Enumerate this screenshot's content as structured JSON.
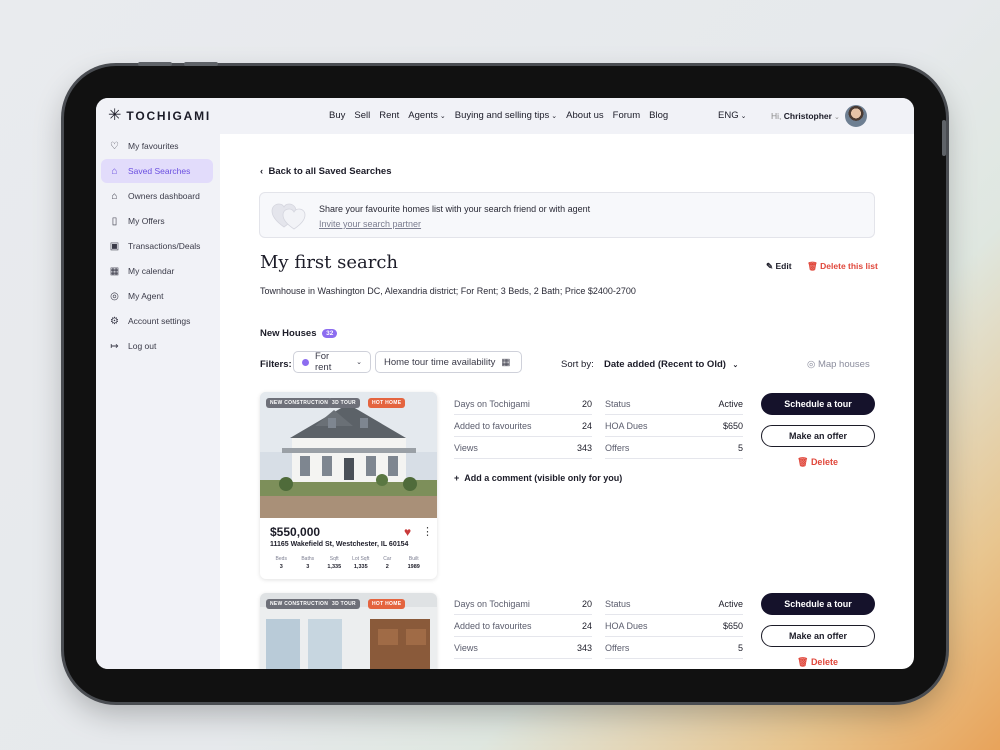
{
  "header": {
    "logo": "TOCHIGAMI",
    "nav": [
      "Buy",
      "Sell",
      "Rent",
      "Agents",
      "Buying and selling tips",
      "About us",
      "Forum",
      "Blog"
    ],
    "language": "ENG",
    "greeting": "Hi,",
    "user_name": "Christopher"
  },
  "sidebar": {
    "items": [
      {
        "label": "My favourites",
        "icon": "heart-icon"
      },
      {
        "label": "Saved Searches",
        "icon": "saved-search-icon",
        "active": true
      },
      {
        "label": "Owners dashboard",
        "icon": "home-icon"
      },
      {
        "label": "My Offers",
        "icon": "document-icon"
      },
      {
        "label": "Transactions/Deals",
        "icon": "briefcase-icon"
      },
      {
        "label": "My calendar",
        "icon": "calendar-icon"
      },
      {
        "label": "My Agent",
        "icon": "user-icon"
      },
      {
        "label": "Account settings",
        "icon": "gear-icon"
      },
      {
        "label": "Log out",
        "icon": "logout-icon"
      }
    ]
  },
  "main": {
    "back_label": "Back to all Saved Searches",
    "share": {
      "text": "Share your favourite homes list with your search friend or with agent",
      "link": "Invite your search partner"
    },
    "title": "My first search",
    "edit_label": "Edit",
    "delete_list_label": "Delete this list",
    "description": "Townhouse in Washington DC, Alexandria district; For Rent; 3 Beds, 2 Bath; Price $2400-2700",
    "section_title": "New Houses",
    "section_count": "32",
    "filters_label": "Filters:",
    "filter_rent": "For rent",
    "filter_tour": "Home tour time availability",
    "sort_label": "Sort by:",
    "sort_value": "Date added (Recent to Old)",
    "map_label": "Map houses"
  },
  "listings": [
    {
      "badges": [
        "NEW CONSTRUCTION",
        "3D TOUR",
        "HOT HOME"
      ],
      "price": "$550,000",
      "address": "11165 Wakefield St, Westchester, IL 60154",
      "specs": [
        {
          "label": "Beds",
          "value": "3"
        },
        {
          "label": "Baths",
          "value": "3"
        },
        {
          "label": "Sqft",
          "value": "1,335"
        },
        {
          "label": "Lot Sqft",
          "value": "1,335"
        },
        {
          "label": "Car",
          "value": "2"
        },
        {
          "label": "Built",
          "value": "1989"
        }
      ],
      "stats_left": [
        {
          "k": "Days on Tochigami",
          "v": "20"
        },
        {
          "k": "Added to favourites",
          "v": "24"
        },
        {
          "k": "Views",
          "v": "343"
        }
      ],
      "stats_right": [
        {
          "k": "Status",
          "v": "Active"
        },
        {
          "k": "HOA Dues",
          "v": "$650"
        },
        {
          "k": "Offers",
          "v": "5"
        }
      ],
      "comment_label": "Add a comment (visible only for you)",
      "schedule_label": "Schedule a tour",
      "offer_label": "Make an offer",
      "delete_label": "Delete"
    },
    {
      "badges": [
        "NEW CONSTRUCTION",
        "3D TOUR",
        "HOT HOME"
      ],
      "stats_left": [
        {
          "k": "Days on Tochigami",
          "v": "20"
        },
        {
          "k": "Added to favourites",
          "v": "24"
        },
        {
          "k": "Views",
          "v": "343"
        }
      ],
      "stats_right": [
        {
          "k": "Status",
          "v": "Active"
        },
        {
          "k": "HOA Dues",
          "v": "$650"
        },
        {
          "k": "Offers",
          "v": "5"
        }
      ],
      "schedule_label": "Schedule a tour",
      "offer_label": "Make an offer",
      "delete_label": "Delete"
    }
  ],
  "colors": {
    "accent": "#8c6cf0",
    "danger": "#e0473b",
    "dark_button": "#15122b",
    "sidebar_bg": "#f1f2f7"
  }
}
